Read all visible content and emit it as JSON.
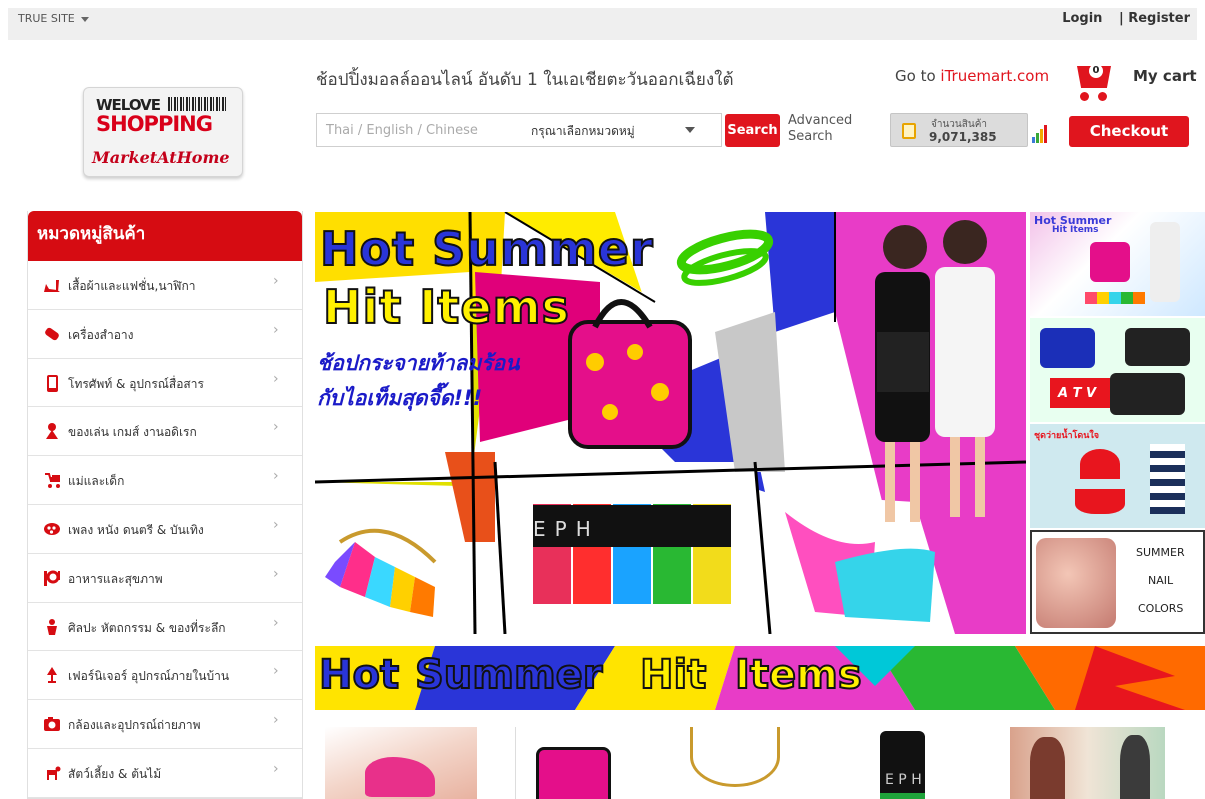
{
  "topbar": {
    "site_switch": "TRUE SITE",
    "login": "Login",
    "register": "| Register"
  },
  "logo": {
    "line1": "WELOVE",
    "line2": "SHOPPING",
    "line3": "MarketAtHome"
  },
  "header": {
    "tagline": "ช้อปปิ้งมอลล์ออนไลน์ อันดับ 1 ในเอเชียตะวันออกเฉียงใต้",
    "search_placeholder": "Thai / English / Chinese",
    "category_select": "กรุณาเลือกหมวดหมู่",
    "search_button": "Search",
    "advanced_line1": "Advanced",
    "advanced_line2": "Search",
    "count_label": "จำนวนสินค้า",
    "count_value": "9,071,385",
    "goto_prefix": "Go to ",
    "goto_link": "iTruemart.com",
    "cart_count": "0",
    "mycart": "My cart",
    "checkout": "Checkout"
  },
  "sidebar": {
    "title": "หมวดหมู่สินค้า",
    "items": [
      {
        "label": "เสื้อผ้าและแฟชั่น,นาฬิกา",
        "icon": "high-heel-icon"
      },
      {
        "label": "เครื่องสำอาง",
        "icon": "lipstick-icon"
      },
      {
        "label": "โทรศัพท์ & อุปกรณ์สื่อสาร",
        "icon": "phone-icon"
      },
      {
        "label": "ของเล่น เกมส์ งานอดิเรก",
        "icon": "toy-icon"
      },
      {
        "label": "แม่และเด็ก",
        "icon": "stroller-icon"
      },
      {
        "label": "เพลง หนัง ดนตรี & บันเทิง",
        "icon": "film-icon"
      },
      {
        "label": "อาหารและสุขภาพ",
        "icon": "utensils-icon"
      },
      {
        "label": "ศิลปะ หัตถกรรม & ของที่ระลึก",
        "icon": "craft-icon"
      },
      {
        "label": "เฟอร์นิเจอร์ อุปกรณ์ภายในบ้าน",
        "icon": "lamp-icon"
      },
      {
        "label": "กล้องและอุปกรณ์ถ่ายภาพ",
        "icon": "camera-icon"
      },
      {
        "label": "สัตว์เลี้ยง & ต้นไม้",
        "icon": "pet-icon"
      }
    ]
  },
  "hero": {
    "title1": "Hot Summer",
    "title2": "Hit Items",
    "thai_line1": "ช้อปกระจายท้าลมร้อน",
    "thai_line2": "กับไอเท็มสุดจี๊ด!!!",
    "polish_brand": "EPH"
  },
  "side_thumbs": {
    "thumb1_title": "Hot Summer",
    "thumb1_title2": "Hit Items",
    "atv": "A T V",
    "swim_title": "ชุดว่ายน้ำโดนใจ",
    "nail1": "SUMMER",
    "nail2": "NAIL",
    "nail3": "COLORS"
  },
  "banner2": {
    "word1": "Hot",
    "word2": "Summer",
    "word3": "Hit",
    "word4": "Items"
  },
  "products": {
    "polish_text": "E P H"
  }
}
